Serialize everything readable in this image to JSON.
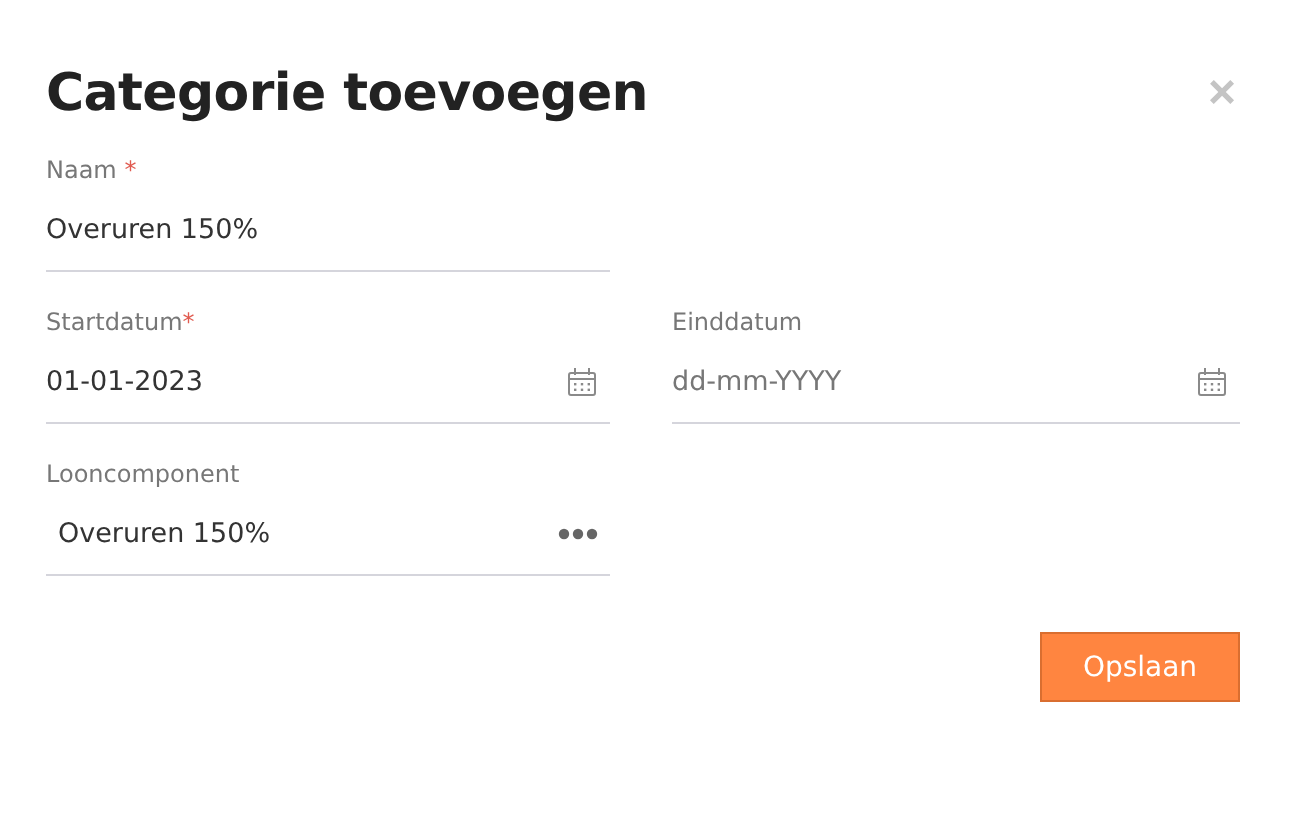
{
  "dialog": {
    "title": "Categorie toevoegen",
    "close": "×"
  },
  "rows": [
    [
      {
        "label": "Naam ",
        "required": "*",
        "value": "Overuren 150%",
        "kind": "text"
      }
    ],
    [
      {
        "label": "Startdatum",
        "required": "*",
        "value": "01-01-2023",
        "kind": "date"
      },
      {
        "label": "Einddatum",
        "placeholder": "dd-mm-YYYY",
        "kind": "date"
      }
    ],
    [
      {
        "label": "Looncomponent",
        "value": "Overuren 150%",
        "kind": "lookup"
      }
    ]
  ],
  "buttons": [
    {
      "label": "Opslaan"
    }
  ]
}
